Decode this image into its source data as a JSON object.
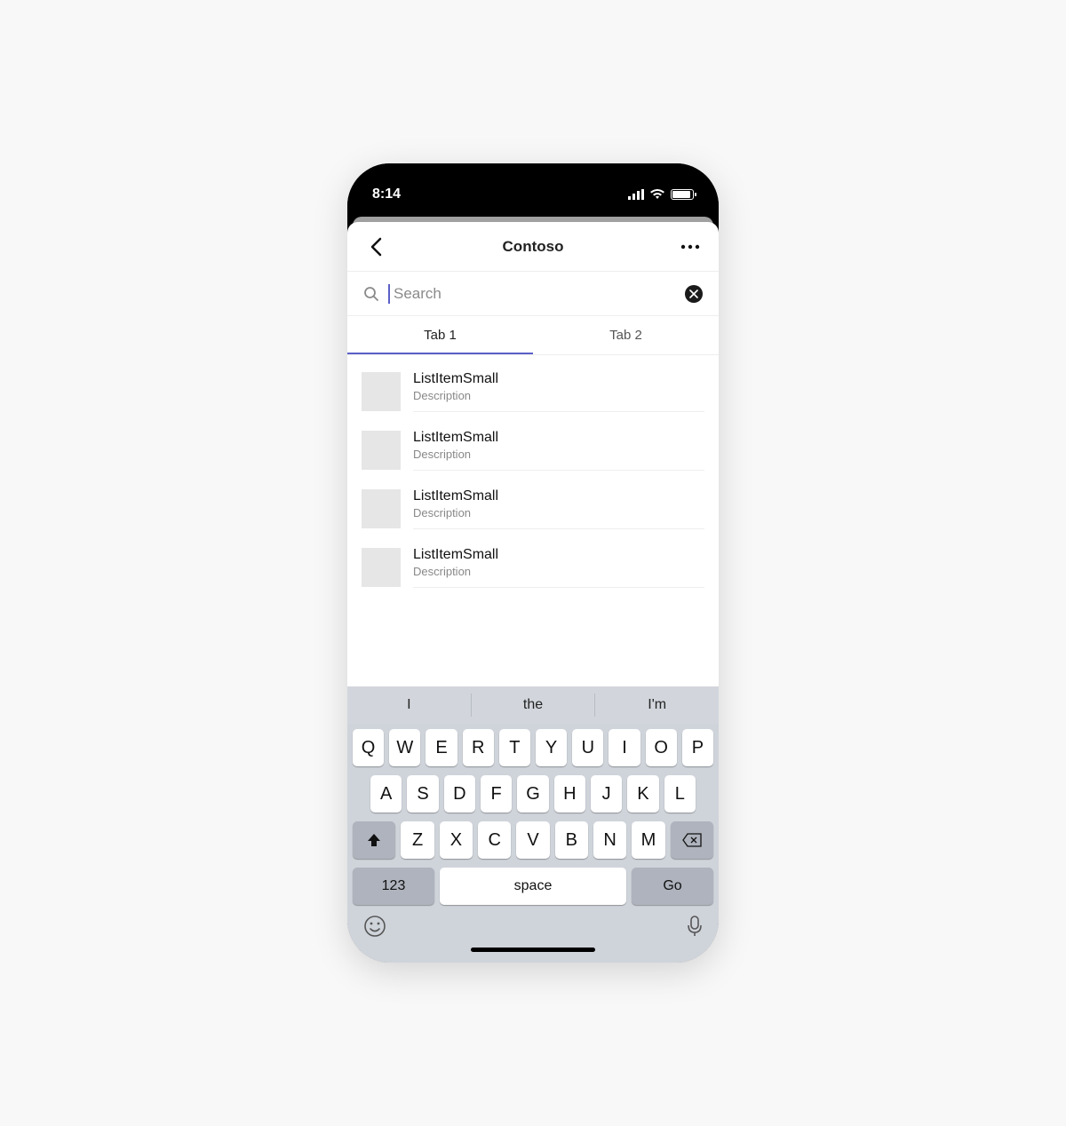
{
  "status": {
    "time": "8:14"
  },
  "header": {
    "title": "Contoso"
  },
  "search": {
    "placeholder": "Search"
  },
  "tabs": [
    {
      "label": "Tab 1",
      "active": true
    },
    {
      "label": "Tab 2",
      "active": false
    }
  ],
  "list": [
    {
      "title": "ListItemSmall",
      "description": "Description"
    },
    {
      "title": "ListItemSmall",
      "description": "Description"
    },
    {
      "title": "ListItemSmall",
      "description": "Description"
    },
    {
      "title": "ListItemSmall",
      "description": "Description"
    }
  ],
  "keyboard": {
    "suggestions": [
      "I",
      "the",
      "I'm"
    ],
    "row1": [
      "Q",
      "W",
      "E",
      "R",
      "T",
      "Y",
      "U",
      "I",
      "O",
      "P"
    ],
    "row2": [
      "A",
      "S",
      "D",
      "F",
      "G",
      "H",
      "J",
      "K",
      "L"
    ],
    "row3": [
      "Z",
      "X",
      "C",
      "V",
      "B",
      "N",
      "M"
    ],
    "num_label": "123",
    "space_label": "space",
    "go_label": "Go"
  },
  "colors": {
    "accent": "#5b5fc7"
  }
}
